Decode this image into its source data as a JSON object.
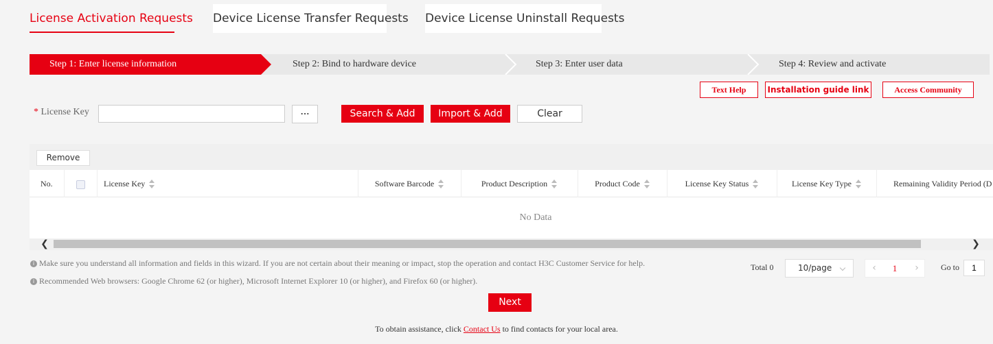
{
  "tabs": [
    {
      "label": "License Activation Requests",
      "active": true
    },
    {
      "label": "Device License Transfer Requests",
      "active": false
    },
    {
      "label": "Device License Uninstall Requests",
      "active": false
    }
  ],
  "steps": [
    {
      "label": "Step 1: Enter license information",
      "active": true
    },
    {
      "label": "Step 2: Bind to hardware device",
      "active": false
    },
    {
      "label": "Step 3: Enter user data",
      "active": false
    },
    {
      "label": "Step 4: Review and activate",
      "active": false
    }
  ],
  "help_links": {
    "text_help": "Text Help",
    "installation_guide": "Installation guide link",
    "access_community": "Access Community"
  },
  "form": {
    "required_mark": "*",
    "license_key_label": "License Key",
    "license_key_value": "",
    "browse_label": "···",
    "search_add": "Search & Add",
    "import_add": "Import & Add",
    "clear": "Clear"
  },
  "table": {
    "remove_label": "Remove",
    "columns": [
      "No.",
      "",
      "License Key",
      "Software Barcode",
      "Product Description",
      "Product Code",
      "License Key Status",
      "License Key Type",
      "Remaining Validity Period (D"
    ],
    "empty_text": "No Data"
  },
  "notes": [
    "Make sure you understand all information and fields in this wizard. If you are not certain about their meaning or impact, stop the operation and contact H3C Customer Service for help.",
    "Recommended Web browsers: Google Chrome 62 (or higher), Microsoft Internet Explorer 10 (or higher), and Firefox 60 (or higher)."
  ],
  "pagination": {
    "total": "Total 0",
    "page_size": "10/page",
    "current_page": "1",
    "goto_label": "Go to",
    "goto_value": "1"
  },
  "next_label": "Next",
  "footer": {
    "before": "To obtain assistance, click ",
    "link": "Contact Us",
    "after": " to find contacts for your local area."
  },
  "colors": {
    "accent": "#e60012",
    "background": "#f4f4f4",
    "step_inactive": "#e8e8e8"
  }
}
